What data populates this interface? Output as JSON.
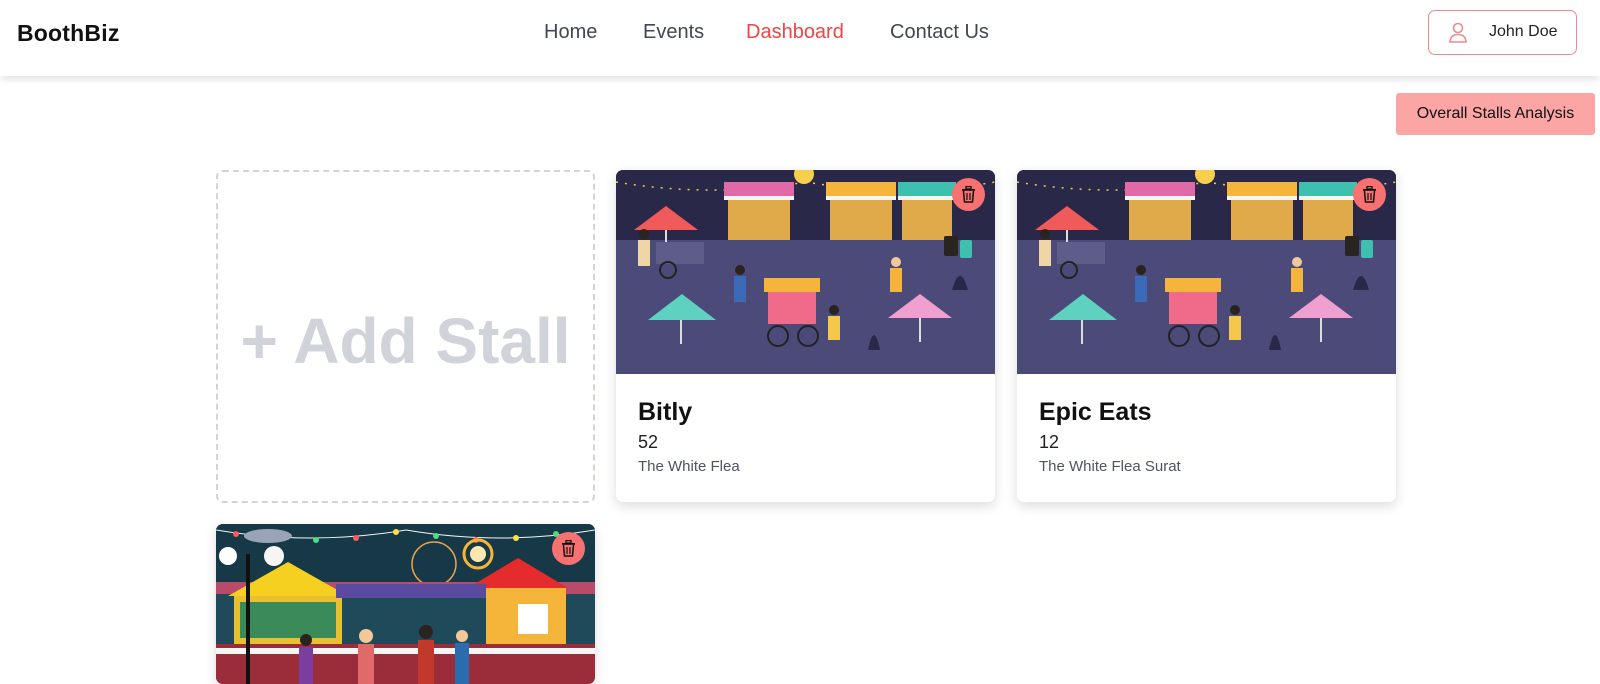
{
  "brand": "BoothBiz",
  "nav": [
    {
      "label": "Home",
      "active": false
    },
    {
      "label": "Events",
      "active": false
    },
    {
      "label": "Dashboard",
      "active": true
    },
    {
      "label": "Contact Us",
      "active": false
    }
  ],
  "user": {
    "name": "John Doe",
    "icon": "user-icon"
  },
  "analysis_button": "Overall Stalls Analysis",
  "add_stall": "+ Add Stall",
  "stalls": [
    {
      "name": "Bitly",
      "count": "52",
      "event": "The White Flea",
      "image": "night-market-illustration"
    },
    {
      "name": "Epic Eats",
      "count": "12",
      "event": "The White Flea Surat",
      "image": "night-market-illustration"
    },
    {
      "name": "",
      "count": "",
      "event": "",
      "image": "carnival-fair-illustration"
    }
  ],
  "colors": {
    "accent": "#ef4444",
    "analysis_button_bg": "#fca5a5",
    "delete_button_bg": "#f87171",
    "market_bg": "#4b4a78",
    "dashed_border": "#d1d5db"
  },
  "icons": {
    "delete": "trash-icon"
  }
}
